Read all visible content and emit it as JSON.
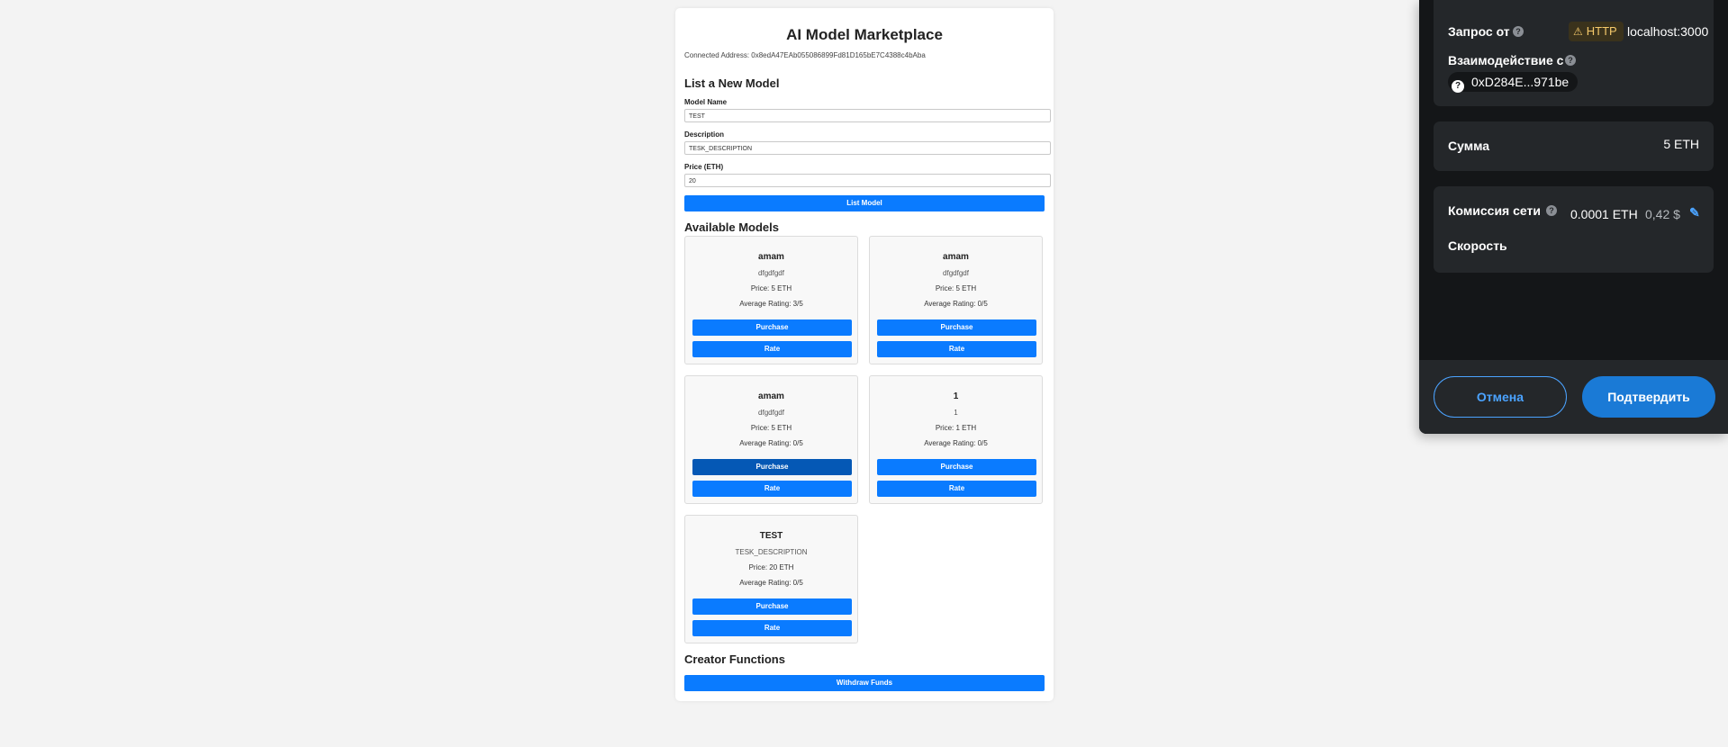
{
  "app": {
    "title": "AI Model Marketplace",
    "connected_address": "Connected Address: 0x8edA47EAb055086899Fd81D165bE7C4388c4bAba",
    "list_heading": "List a New Model",
    "form": {
      "name_label": "Model Name",
      "name_value": "TEST",
      "desc_label": "Description",
      "desc_value": "TESK_DESCRIPTION",
      "price_label": "Price (ETH)",
      "price_value": "20",
      "submit_label": "List Model"
    },
    "available_heading": "Available Models",
    "models": [
      {
        "name": "amam",
        "description": "dfgdfgdf",
        "price": "Price: 5 ETH",
        "rating": "Average Rating: 3/5",
        "purchase": "Purchase",
        "rate": "Rate"
      },
      {
        "name": "amam",
        "description": "dfgdfgdf",
        "price": "Price: 5 ETH",
        "rating": "Average Rating: 0/5",
        "purchase": "Purchase",
        "rate": "Rate"
      },
      {
        "name": "amam",
        "description": "dfgdfgdf",
        "price": "Price: 5 ETH",
        "rating": "Average Rating: 0/5",
        "purchase": "Purchase",
        "rate": "Rate"
      },
      {
        "name": "1",
        "description": "1",
        "price": "Price: 1 ETH",
        "rating": "Average Rating: 0/5",
        "purchase": "Purchase",
        "rate": "Rate"
      },
      {
        "name": "TEST",
        "description": "TESK_DESCRIPTION",
        "price": "Price: 20 ETH",
        "rating": "Average Rating: 0/5",
        "purchase": "Purchase",
        "rate": "Rate"
      }
    ],
    "creator_heading": "Creator Functions",
    "withdraw_label": "Withdraw Funds"
  },
  "wallet": {
    "request_from_label": "Запрос от",
    "http_badge": "HTTP",
    "origin": "localhost:3000",
    "interaction_label": "Взаимодействие с",
    "contract_address": "0xD284E...971be",
    "amount_label": "Сумма",
    "amount_value": "5 ETH",
    "fee_label": "Комиссия сети",
    "fee_eth": "0.0001 ETH",
    "fee_fiat": "0,42 $",
    "speed_label": "Скорость",
    "cancel_label": "Отмена",
    "confirm_label": "Подтвердить"
  },
  "colors": {
    "primary_button": "#0a7bff",
    "button_hover": "#0558b5",
    "wallet_bg": "#141618",
    "wallet_section": "#24272a",
    "wallet_accent": "#1a7ad6",
    "warning": "#f5c96a"
  }
}
